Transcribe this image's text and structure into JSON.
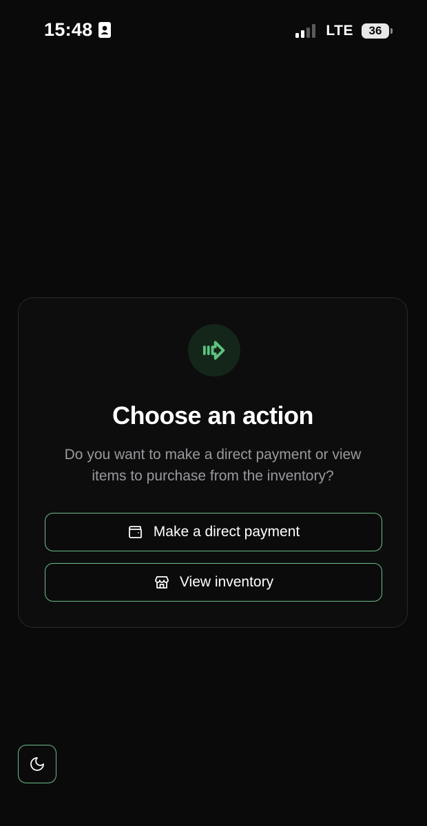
{
  "status_bar": {
    "time": "15:48",
    "network": "LTE",
    "battery": "36"
  },
  "card": {
    "icon": "arrow-right-enter-icon",
    "title": "Choose an action",
    "description": "Do you want to make a direct payment or view items to purchase from the inventory?",
    "actions": [
      {
        "label": "Make a direct payment",
        "icon": "wallet-icon"
      },
      {
        "label": "View inventory",
        "icon": "store-icon"
      }
    ]
  },
  "theme_toggle": {
    "icon": "moon-icon"
  },
  "colors": {
    "accent": "#6cc08a",
    "background": "#0a0a0b",
    "icon_bg": "#14261a"
  }
}
